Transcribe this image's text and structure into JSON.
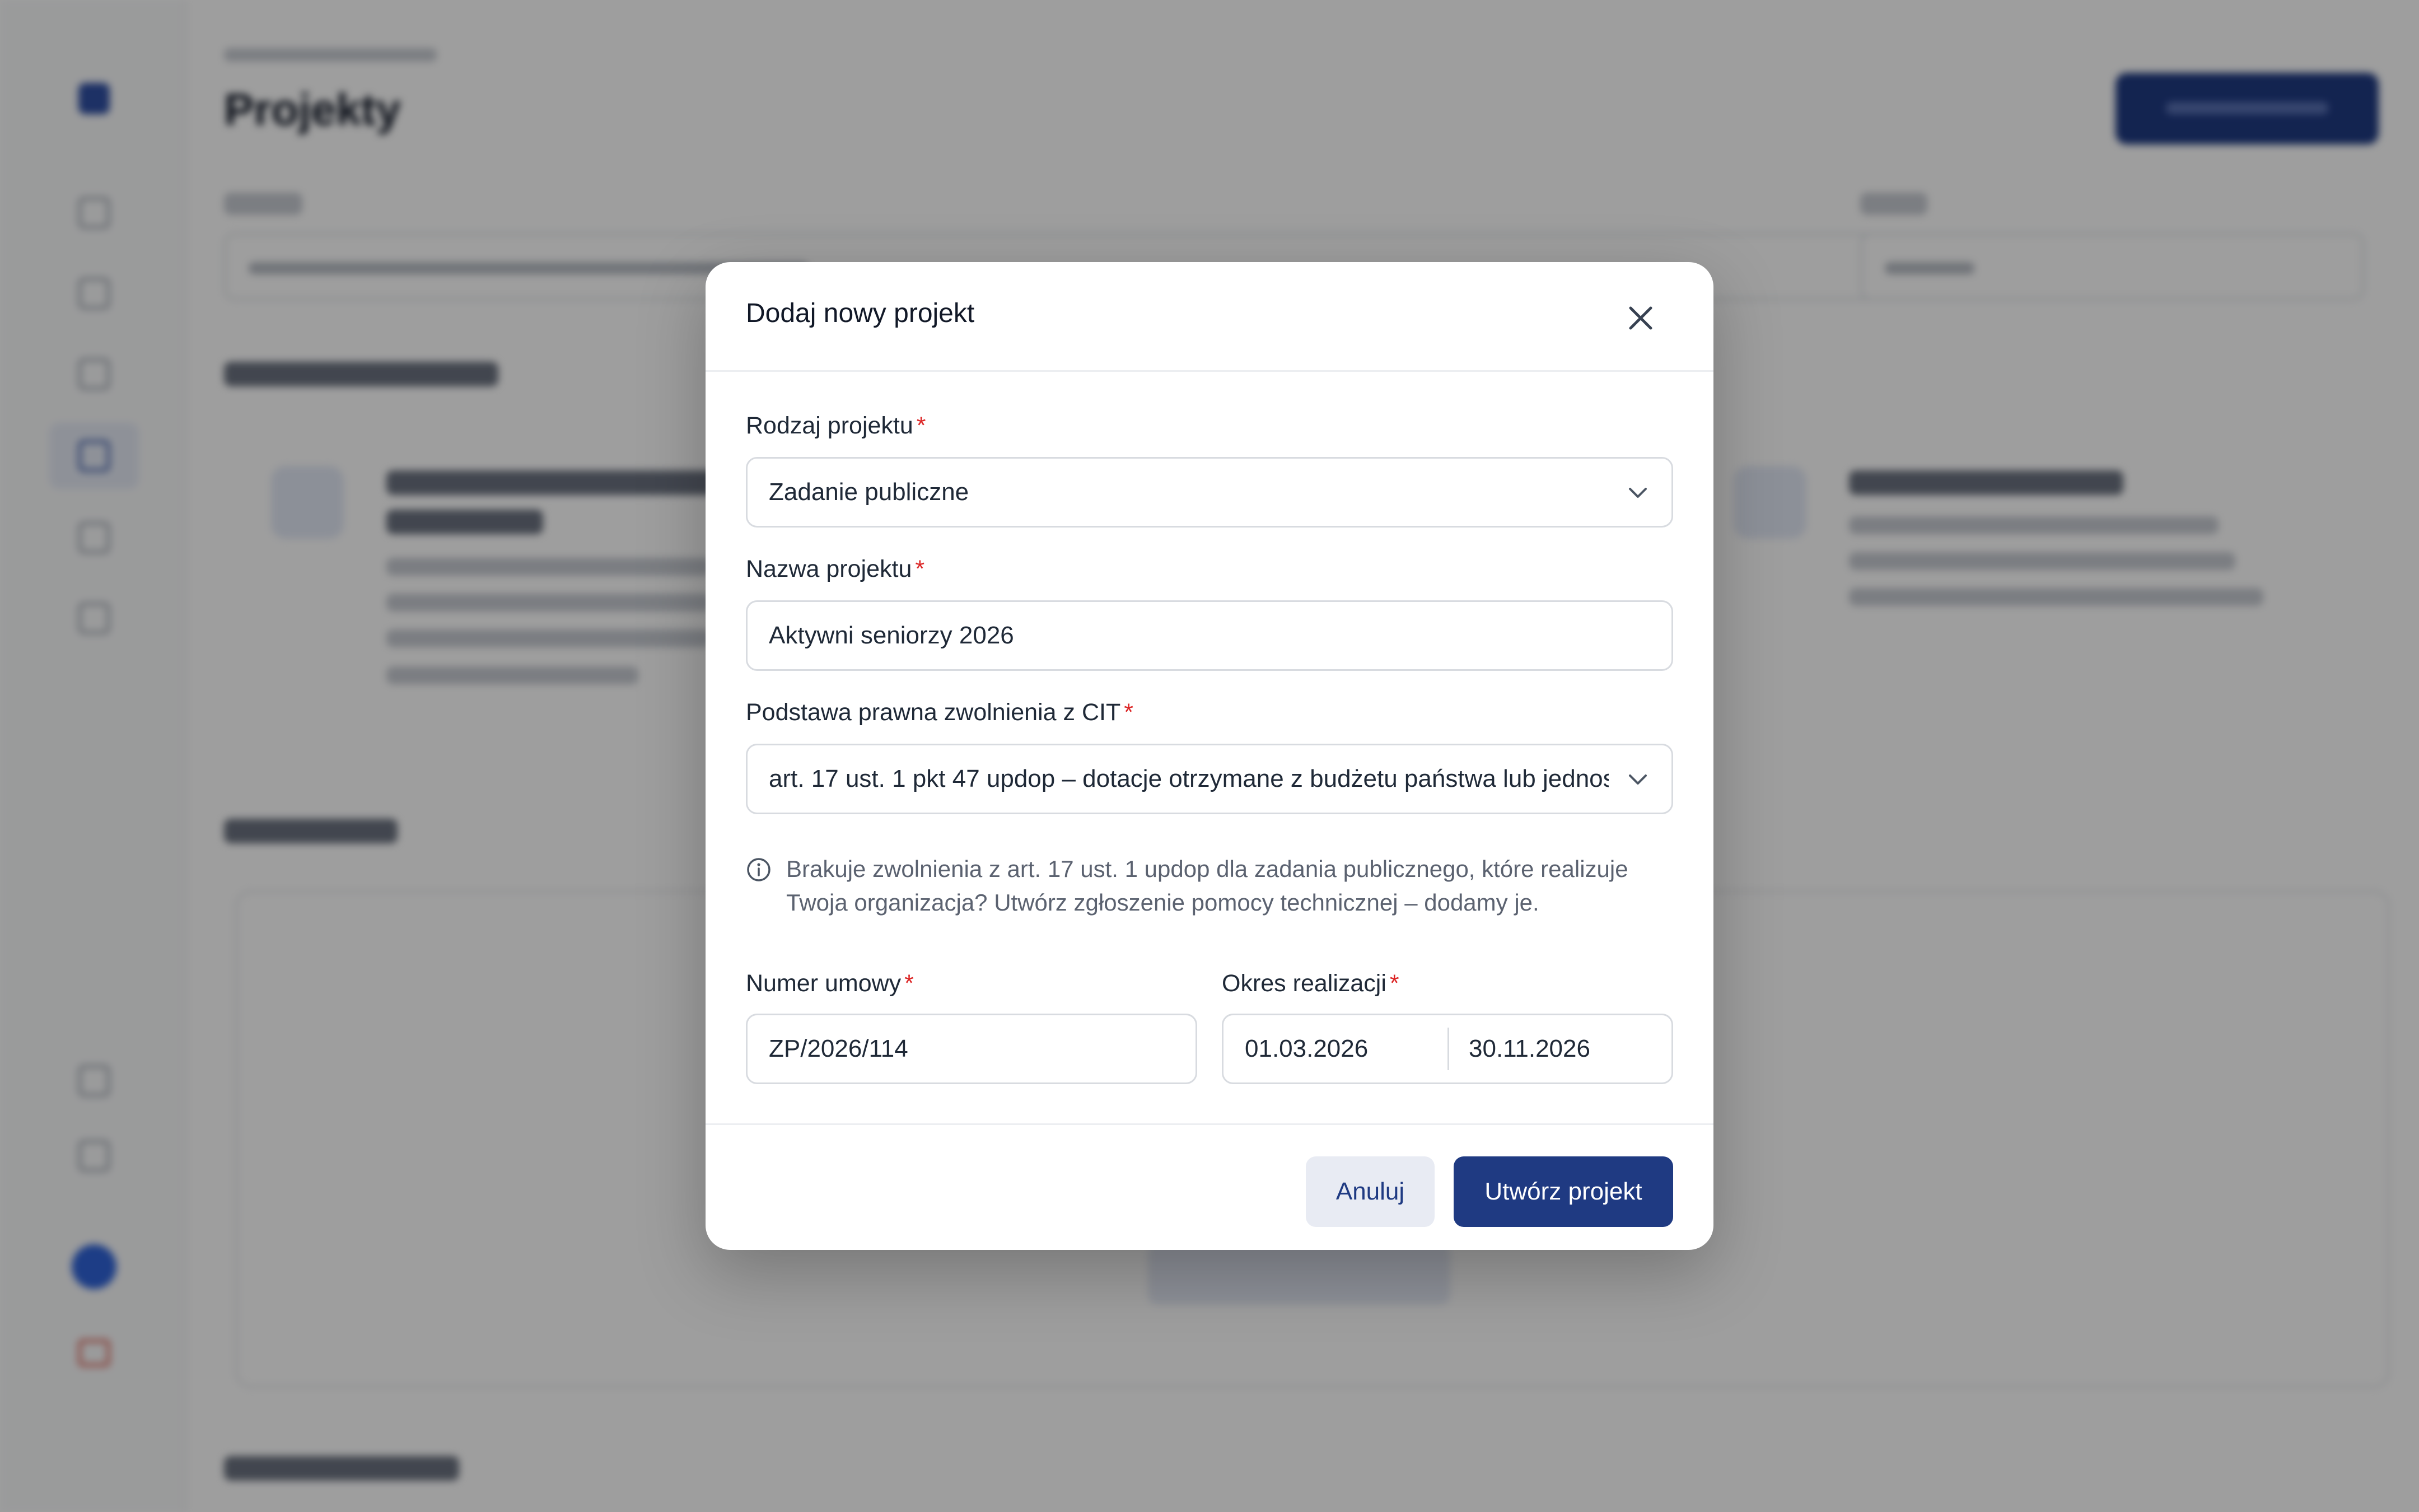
{
  "page": {
    "title": "Projekty"
  },
  "colors": {
    "primary": "#1f3a82",
    "required": "#dc2626",
    "overlay": "rgba(0,0,0,0.38)"
  },
  "modal": {
    "title": "Dodaj nowy projekt",
    "close_icon": "close-icon",
    "fields": {
      "project_type": {
        "label": "Rodzaj projektu",
        "required_mark": "*",
        "value": "Zadanie publiczne"
      },
      "project_name": {
        "label": "Nazwa projektu",
        "required_mark": "*",
        "value": "Aktywni seniorzy 2026"
      },
      "legal_basis": {
        "label": "Podstawa prawna zwolnienia z CIT",
        "required_mark": "*",
        "value": "art. 17 ust. 1 pkt 47 updop – dotacje otrzymane z budżetu państwa lub jednos"
      },
      "contract_number": {
        "label": "Numer umowy",
        "required_mark": "*",
        "value": "ZP/2026/114"
      },
      "period": {
        "label": "Okres realizacji",
        "required_mark": "*",
        "start": "01.03.2026",
        "end": "30.11.2026"
      }
    },
    "info": {
      "icon": "info-icon",
      "text": "Brakuje zwolnienia z art. 17 ust. 1 updop dla zadania publicznego, które realizuje Twoja organizacja? Utwórz zgłoszenie pomocy technicznej – dodamy je."
    },
    "buttons": {
      "cancel": "Anuluj",
      "create": "Utwórz projekt"
    }
  }
}
